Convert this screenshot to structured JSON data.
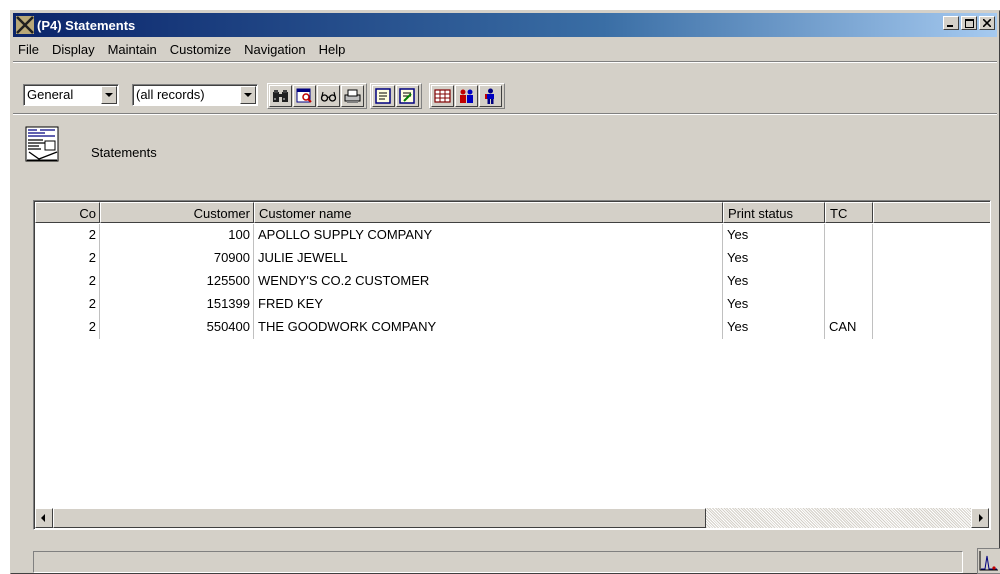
{
  "window": {
    "title": "(P4) Statements"
  },
  "menu": [
    "File",
    "Display",
    "Maintain",
    "Customize",
    "Navigation",
    "Help"
  ],
  "toolbar": {
    "view_select": {
      "value": "General"
    },
    "filter_select": {
      "value": "(all records)"
    },
    "buttons": [
      "find-binoculars-icon",
      "detail-view-icon",
      "preview-glasses-icon",
      "print-icon",
      "notes-icon",
      "edit-notes-icon",
      "grid-view-icon",
      "people-icon",
      "person-icon"
    ]
  },
  "form": {
    "icon": "statement-document-icon",
    "title": "Statements"
  },
  "grid": {
    "columns": [
      "Co",
      "Customer",
      "Customer name",
      "Print status",
      "TC",
      ""
    ],
    "rows": [
      {
        "co": "2",
        "customer": "100",
        "name": "APOLLO SUPPLY COMPANY",
        "print_status": "Yes",
        "tc": ""
      },
      {
        "co": "2",
        "customer": "70900",
        "name": "JULIE JEWELL",
        "print_status": "Yes",
        "tc": ""
      },
      {
        "co": "2",
        "customer": "125500",
        "name": "WENDY'S CO.2 CUSTOMER",
        "print_status": "Yes",
        "tc": ""
      },
      {
        "co": "2",
        "customer": "151399",
        "name": "FRED KEY",
        "print_status": "Yes",
        "tc": ""
      },
      {
        "co": "2",
        "customer": "550400",
        "name": "THE GOODWORK COMPANY",
        "print_status": "Yes",
        "tc": "CAN"
      }
    ]
  },
  "colors": {
    "title_bar_start": "#0a246a",
    "title_bar_end": "#a6caf0",
    "window_face": "#d4d0c8"
  }
}
